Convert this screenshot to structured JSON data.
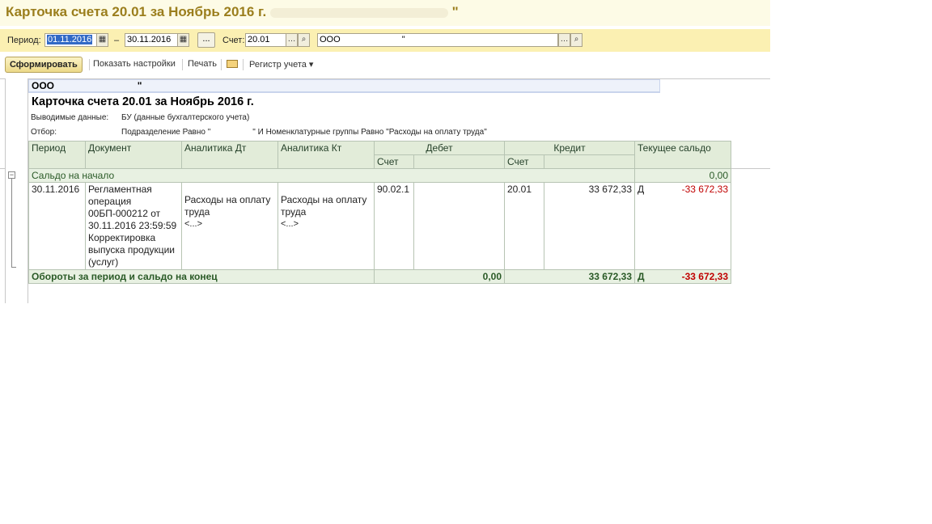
{
  "title": {
    "text": "Карточка счета 20.01 за Ноябрь 2016 г.",
    "suffix": "\""
  },
  "filter": {
    "period_label": "Период:",
    "date_from": "01.11.2016",
    "dash": "–",
    "date_to": "30.11.2016",
    "dots": "...",
    "account_label": "Счет:",
    "account_value": "20.01",
    "org_value": "ООО",
    "org_suffix": "\""
  },
  "toolbar": {
    "generate": "Сформировать",
    "settings": "Показать настройки",
    "print": "Печать",
    "register": "Регистр учета ▾"
  },
  "report": {
    "org_line": "ООО",
    "org_line_suffix": "\"",
    "title": "Карточка счета 20.01 за Ноябрь 2016 г.",
    "output_label": "Выводимые данные:",
    "output_value": "БУ (данные бухгалтерского учета)",
    "filter_label": "Отбор:",
    "filter_value_1": "Подразделение Равно \"",
    "filter_value_2": "\" И Номенклатурные группы Равно \"Расходы на оплату труда\""
  },
  "table": {
    "headers": {
      "period": "Период",
      "document": "Документ",
      "analytics_dt": "Аналитика Дт",
      "analytics_kt": "Аналитика Кт",
      "debit": "Дебет",
      "credit": "Кредит",
      "balance": "Текущее сальдо",
      "account": "Счет"
    },
    "opening": {
      "label": "Сальдо на начало",
      "value": "0,00"
    },
    "row": {
      "date": "30.11.2016",
      "document": "Регламентная операция 00БП-000212 от 30.11.2016 23:59:59 Корректировка выпуска продукции (услуг)",
      "analytics_dt_1": "Расходы на оплату труда",
      "analytics_dt_2": "<...>",
      "analytics_kt_1": "Расходы на оплату труда",
      "analytics_kt_2": "<...>",
      "debit_account": "90.02.1",
      "credit_account": "20.01",
      "credit_amount": "33 672,33",
      "balance_side": "Д",
      "balance_amount": "-33 672,33"
    },
    "totals": {
      "label": "Обороты за период и сальдо на конец",
      "debit": "0,00",
      "credit": "33 672,33",
      "side": "Д",
      "balance": "-33 672,33"
    }
  },
  "colors": {
    "title": "#9b7e1d",
    "filter_bar": "#fbf0b2",
    "group_row": "#e8f1e2",
    "negative": "#c00000"
  }
}
